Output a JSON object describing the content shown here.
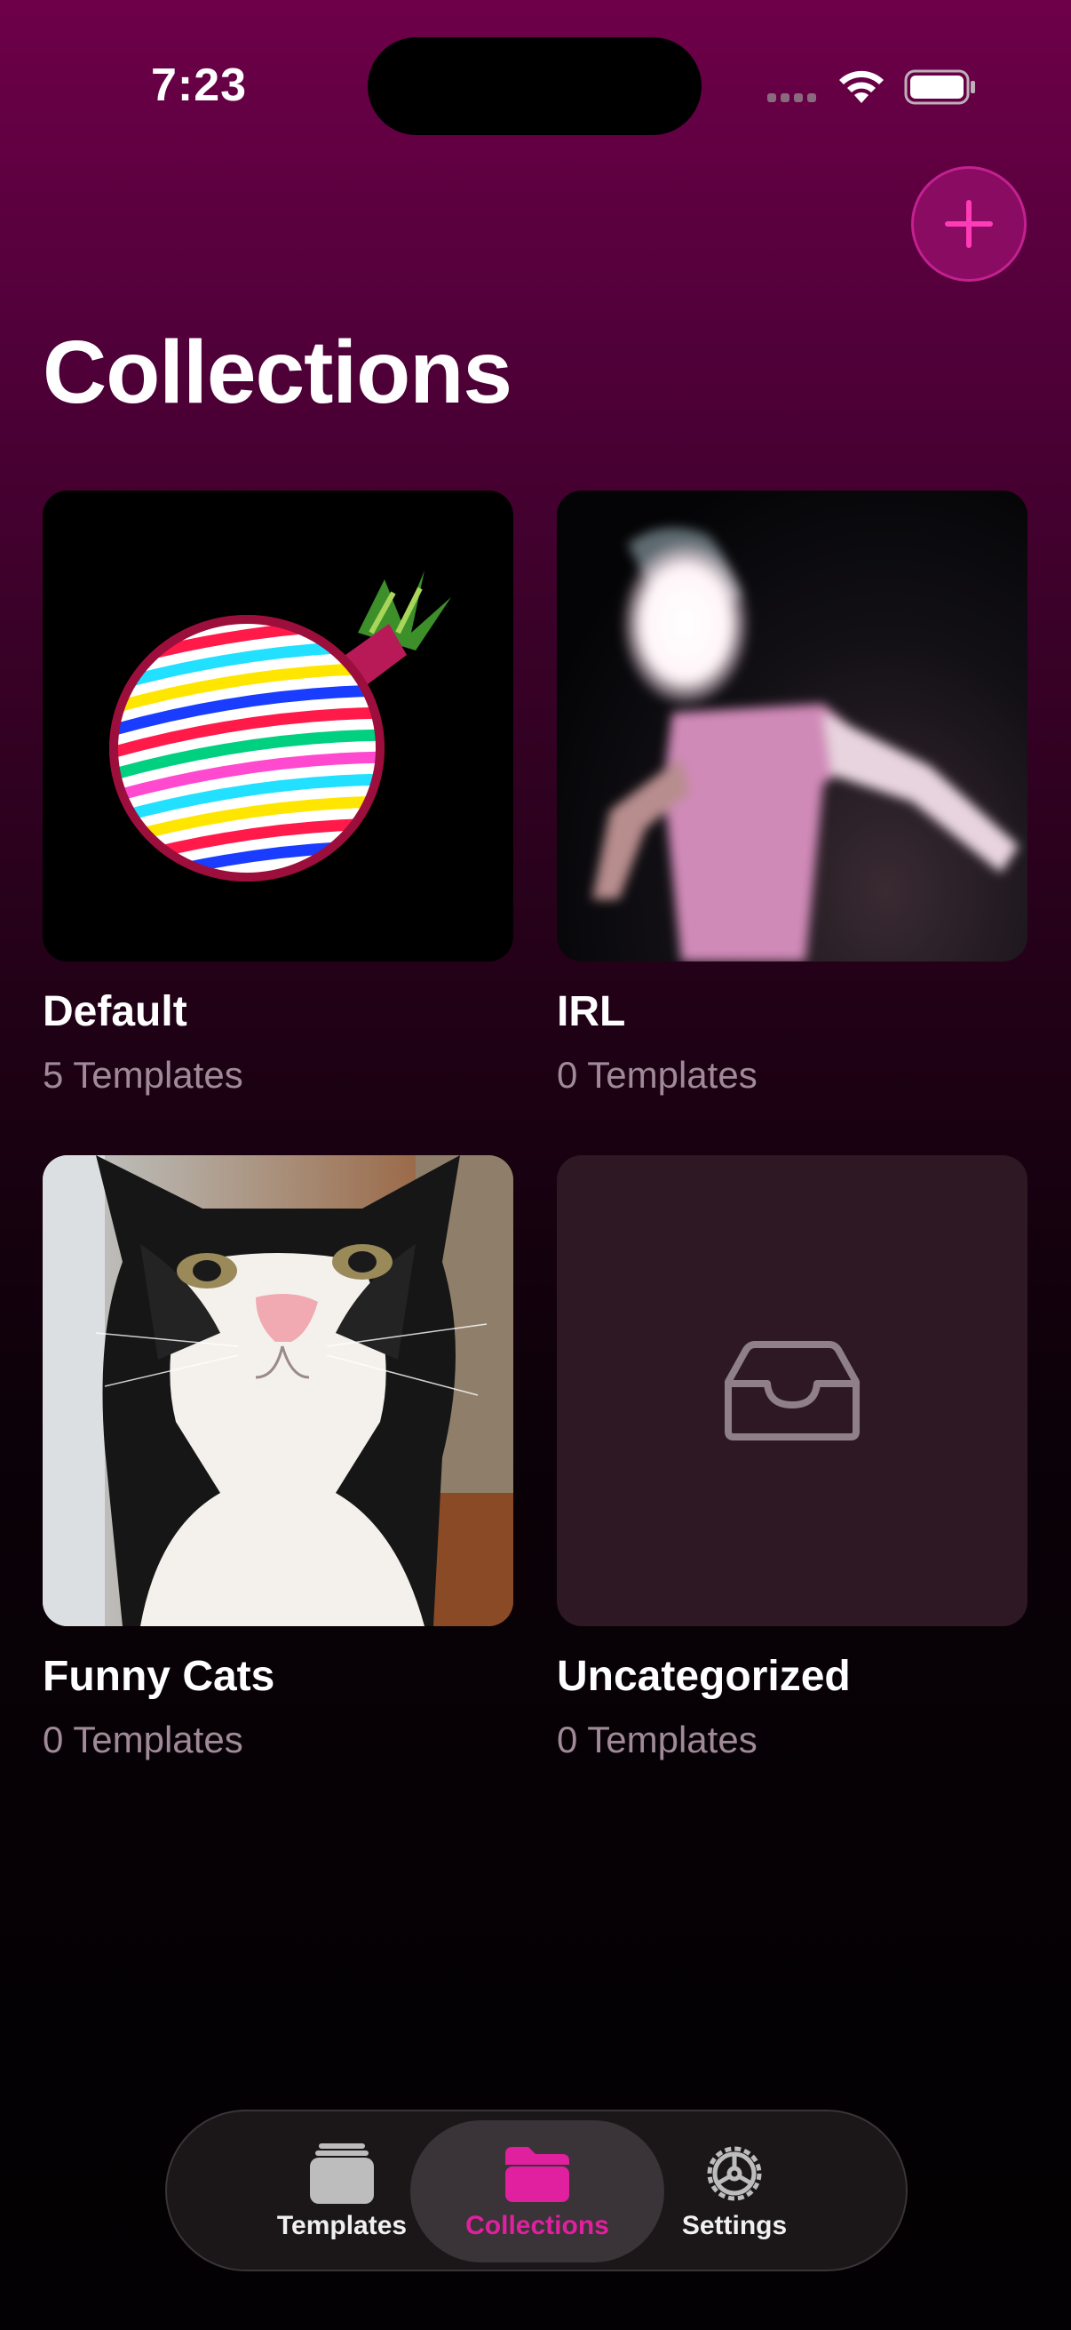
{
  "status_bar": {
    "time": "7:23"
  },
  "header": {
    "title": "Collections",
    "add_button_icon": "plus-icon"
  },
  "collections": [
    {
      "name": "Default",
      "count": "5 Templates",
      "thumbnail": "rainbow-onion-image"
    },
    {
      "name": "IRL",
      "count": "0 Templates",
      "thumbnail": "dancing-person-image"
    },
    {
      "name": "Funny Cats",
      "count": "0 Templates",
      "thumbnail": "cat-photo-image"
    },
    {
      "name": "Uncategorized",
      "count": "0 Templates",
      "thumbnail": "tray-icon"
    }
  ],
  "tab_bar": {
    "tabs": [
      {
        "label": "Templates",
        "icon": "stack-icon",
        "active": false
      },
      {
        "label": "Collections",
        "icon": "folder-icon",
        "active": true
      },
      {
        "label": "Settings",
        "icon": "gear-icon",
        "active": false
      }
    ]
  },
  "colors": {
    "accent": "#e0209e",
    "inactive_tab": "#f0f0f0",
    "secondary_text": "#a08a98",
    "gradient_top": "#6e0049",
    "gradient_bottom": "#030103"
  }
}
